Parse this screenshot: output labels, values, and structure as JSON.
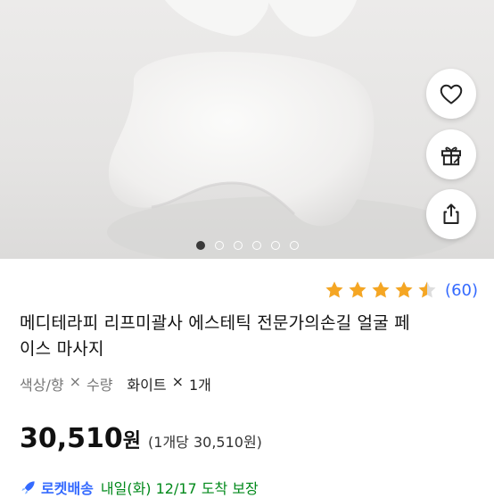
{
  "product": {
    "title": "메디테라피 리프미괄사 에스테틱 전문가의손길 얼굴 페이스 마사지",
    "title_line1": "메디테라피 리프미괄사 에스테틱 전문가의손길 얼굴 페",
    "title_line2": "이스 마사지"
  },
  "gallery": {
    "total_images": 6,
    "active_index": 0
  },
  "actions": {
    "wishlist_icon": "heart-icon",
    "gift_icon": "gift-icon",
    "share_icon": "share-icon"
  },
  "rating": {
    "stars": 4.5,
    "max": 5,
    "review_count": "(60)"
  },
  "option": {
    "label_color": "색상/향",
    "times": "×",
    "label_qty": "수량",
    "value": "화이트",
    "value_times": "×",
    "value_qty": "1개"
  },
  "price": {
    "amount": "30,510",
    "currency": "원",
    "unit_price": "(1개당 30,510원)"
  },
  "delivery": {
    "badge": "로켓배송",
    "arrival": "내일(화) 12/17 도착 보장"
  },
  "colors": {
    "accent_blue": "#346aff",
    "star": "#f5a623",
    "arrival_green": "#00891a"
  }
}
